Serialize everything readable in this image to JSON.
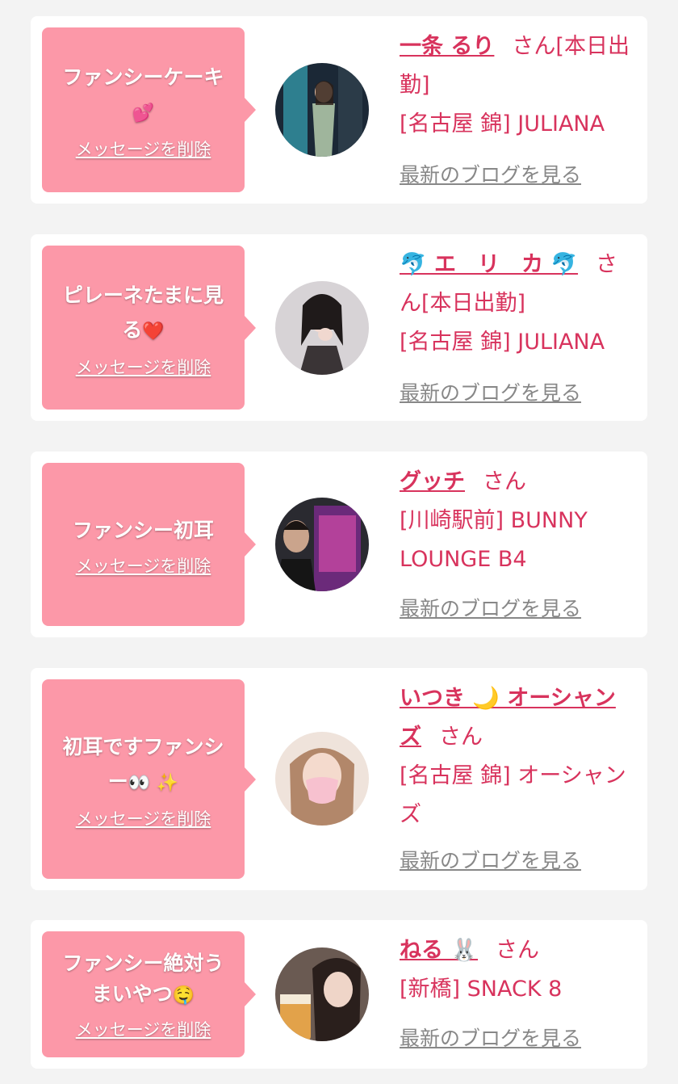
{
  "delete_label": "メッセージを削除",
  "blog_label": "最新のブログを見る",
  "honorific": "さん",
  "colors": {
    "accent": "#d8335d",
    "bubble": "#fc98a8",
    "link_gray": "#888888",
    "background": "#f3f3f3"
  },
  "cards": [
    {
      "message": "ファンシーケーキ",
      "message_emoji": "💕",
      "name": "一条 るり",
      "status": "[本日出勤]",
      "shop": "[名古屋 錦] JULIANA"
    },
    {
      "message": "ピレーネたまに見る",
      "message_emoji": "❤️",
      "name": "🐬 エ　リ　カ 🐬",
      "status": "[本日出勤]",
      "shop": "[名古屋 錦] JULIANA"
    },
    {
      "message": "ファンシー初耳",
      "message_emoji": "",
      "name": "グッチ",
      "status": "",
      "shop": "[川崎駅前] BUNNY LOUNGE B4"
    },
    {
      "message": "初耳ですファンシー",
      "message_emoji": "👀 ✨",
      "name": "いつき 🌙 オーシャンズ",
      "status": "",
      "shop": "[名古屋 錦] オーシャンズ"
    },
    {
      "message": "ファンシー絶対うまいやつ",
      "message_emoji": "🤤",
      "name": "ねる 🐰",
      "status": "",
      "shop": "[新橋] SNACK 8"
    }
  ]
}
